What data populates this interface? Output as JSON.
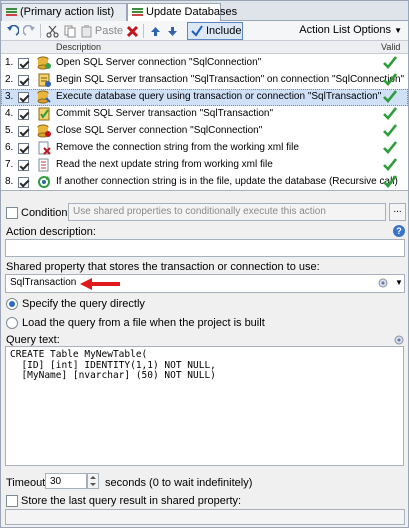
{
  "tabs": [
    {
      "label": "(Primary action list)",
      "active": false
    },
    {
      "label": "Update Databases",
      "active": true
    }
  ],
  "toolbar": {
    "paste_label": "Paste",
    "include_label": "Include",
    "options_label": "Action List Options"
  },
  "list": {
    "col_description": "Description",
    "col_valid": "Valid",
    "rows": [
      {
        "num": "1.",
        "text": "Open SQL Server connection \"SqlConnection\"",
        "icon": "database-open-icon",
        "checked": true,
        "valid": true,
        "selected": false
      },
      {
        "num": "2.",
        "text": "Begin SQL Server transaction \"SqlTransaction\" on connection \"SqlConnection\"",
        "icon": "transaction-begin-icon",
        "checked": true,
        "valid": true,
        "selected": false
      },
      {
        "num": "3.",
        "text": "Execute database query using transaction or connection \"SqlTransaction\"",
        "icon": "database-query-icon",
        "checked": true,
        "valid": true,
        "selected": true
      },
      {
        "num": "4.",
        "text": "Commit SQL Server transaction \"SqlTransaction\"",
        "icon": "transaction-commit-icon",
        "checked": true,
        "valid": true,
        "selected": false
      },
      {
        "num": "5.",
        "text": "Close SQL Server connection \"SqlConnection\"",
        "icon": "database-close-icon",
        "checked": true,
        "valid": true,
        "selected": false
      },
      {
        "num": "6.",
        "text": "Remove the connection string from the working xml file",
        "icon": "xml-remove-icon",
        "checked": true,
        "valid": true,
        "selected": false
      },
      {
        "num": "7.",
        "text": "Read the next update string from working xml file",
        "icon": "xml-read-icon",
        "checked": true,
        "valid": true,
        "selected": false
      },
      {
        "num": "8.",
        "text": "If another connection string is in the file, update the database (Recursive call)",
        "icon": "recursive-call-icon",
        "checked": true,
        "valid": true,
        "selected": false
      }
    ]
  },
  "condition": {
    "label": "Condition:",
    "placeholder": "Use shared properties to conditionally execute this action",
    "browse_label": "..."
  },
  "action_description": {
    "label": "Action description:",
    "value": ""
  },
  "shared_property": {
    "label": "Shared property that stores the transaction or connection to use:",
    "value": "SqlTransaction"
  },
  "query_source": {
    "option_direct": "Specify the query directly",
    "option_file": "Load the query from a file when the project is built",
    "selected": "direct"
  },
  "query_text": {
    "label": "Query text:",
    "lines": [
      "CREATE Table MyNewTable(",
      "  [ID] [int] IDENTITY(1,1) NOT NULL,",
      "  [MyName] [nvarchar] (50) NOT NULL)"
    ]
  },
  "timeout": {
    "label": "Timeout:",
    "value": "30",
    "suffix": "seconds (0 to wait indefinitely)"
  },
  "store_result": {
    "label": "Store the last query result in shared property:",
    "value": ""
  },
  "colors": {
    "selection": "#cfe0f7",
    "check_green": "#2e9e3a",
    "arrow_red": "#e0191d",
    "delete_red": "#c0161c"
  }
}
